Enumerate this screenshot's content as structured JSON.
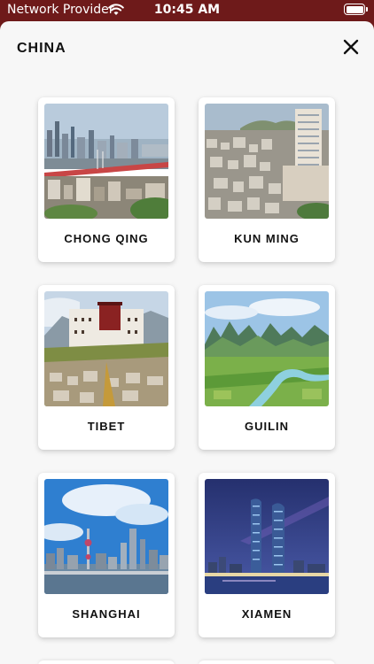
{
  "status_bar": {
    "carrier": "Network Provider",
    "time": "10:45 AM",
    "icons": [
      "wifi-icon",
      "battery-icon"
    ]
  },
  "header": {
    "title": "CHINA",
    "close_icon": "close-icon"
  },
  "colors": {
    "status_bar_background": "#6e1a1a",
    "sheet_background": "#f7f7f7",
    "card_background": "#ffffff"
  },
  "destinations": [
    {
      "label": "CHONG QING"
    },
    {
      "label": "KUN MING"
    },
    {
      "label": "TIBET"
    },
    {
      "label": "GUILIN"
    },
    {
      "label": "SHANGHAI"
    },
    {
      "label": "XIAMEN"
    }
  ]
}
